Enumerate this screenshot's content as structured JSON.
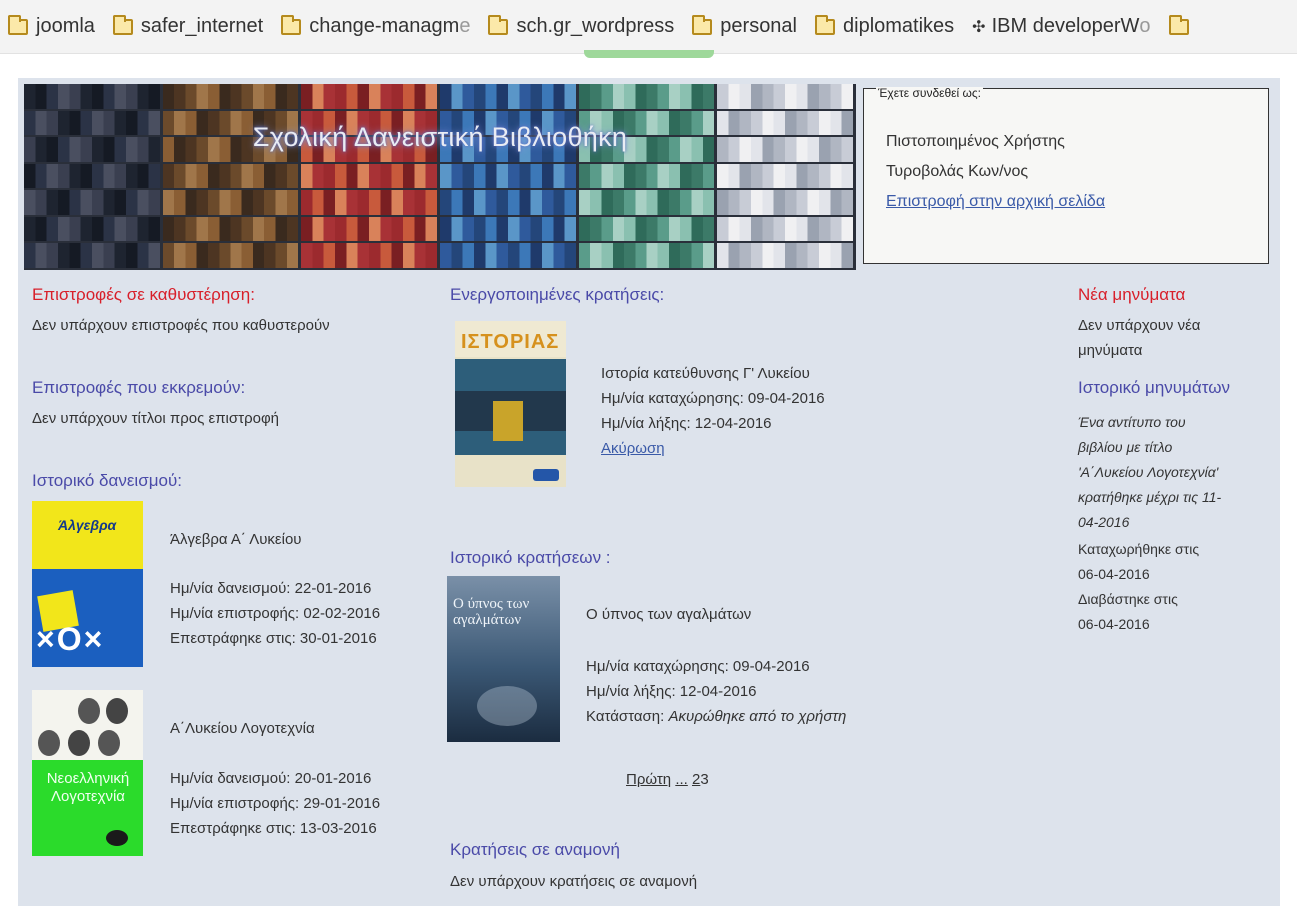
{
  "bookmarks": [
    {
      "label": "joomla",
      "icon": "folder-icon"
    },
    {
      "label": "safer_internet",
      "icon": "folder-icon"
    },
    {
      "label": "change-managm",
      "icon": "folder-icon",
      "faded_tail": "e"
    },
    {
      "label": "sch.gr_wordpress",
      "icon": "folder-icon"
    },
    {
      "label": "personal",
      "icon": "folder-icon"
    },
    {
      "label": "diplomatikes",
      "icon": "folder-icon"
    },
    {
      "label": "IBM developerW",
      "icon": "ibm-icon",
      "faded_tail": "o"
    }
  ],
  "banner": {
    "title": "Σχολική Δανειστική Βιβλιοθήκη"
  },
  "login": {
    "legend": "Έχετε συνδεθεί ως:",
    "role": "Πιστοποιημένος Χρήστης",
    "name": "Τυροβολάς  Κων/νος",
    "home_link": "Επιστροφή στην αρχική σελίδα"
  },
  "left": {
    "overdue_heading": "Επιστροφές σε καθυστέρηση:",
    "overdue_text": "Δεν υπάρχουν επιστροφές που καθυστερούν",
    "pending_heading": "Επιστροφές που εκκρεμούν:",
    "pending_text": "Δεν υπάρχουν τίτλοι προς επιστροφή",
    "history_heading": "Ιστορικό δανεισμού:",
    "loans": [
      {
        "title": "Άλγεβρα Α΄ Λυκείου",
        "loan_date": "Ημ/νία δανεισμού: 22-01-2016",
        "due_date": "Ημ/νία επιστροφής: 02-02-2016",
        "returned": "Επεστράφηκε στις: 30-01-2016",
        "cover_text": "Άλγεβρα"
      },
      {
        "title": "Α΄Λυκείου Λογοτεχνία",
        "loan_date": "Ημ/νία δανεισμού: 20-01-2016",
        "due_date": "Ημ/νία επιστροφής: 29-01-2016",
        "returned": "Επεστράφηκε στις: 13-03-2016",
        "cover_text": "Νεοελληνική Λογοτεχνία"
      }
    ]
  },
  "middle": {
    "active_heading": "Ενεργοποιημένες κρατήσεις:",
    "active": {
      "title": "Ιστορία κατεύθυνσης Γ' Λυκείου",
      "reg_date": "Ημ/νία καταχώρησης: 09-04-2016",
      "exp_date": "Ημ/νία λήξης: 12-04-2016",
      "cancel": "Ακύρωση ",
      "cover_text": "ΙΣΤΟΡΙΑΣ"
    },
    "history_heading": "Ιστορικό κρατήσεων :",
    "history": {
      "title": "Ο ύπνος των αγαλμάτων",
      "reg_date": "Ημ/νία καταχώρησης: 09-04-2016",
      "exp_date": "Ημ/νία λήξης: 12-04-2016",
      "status_label": "Κατάσταση: ",
      "status_value": "Ακυρώθηκε από το χρήστη",
      "cover_text": "Ο ύπνος των αγαλμάτων"
    },
    "pager": {
      "first": "Πρώτη",
      "dots": "...",
      "p2": "2",
      "p3": "3"
    },
    "waiting_heading": "Κρατήσεις σε αναμονή",
    "waiting_text": "Δεν υπάρχουν κρατήσεις σε αναμονή"
  },
  "right": {
    "new_heading": "Νέα μηνύματα",
    "new_text_1": "Δεν υπάρχουν νέα",
    "new_text_2": "μηνύματα",
    "history_heading": "Ιστορικό μηνυμάτων",
    "msg_lines": [
      "Ένα αντίτυπο του",
      "βιβλίου με τίτλο",
      "'Α΄Λυκείου Λογοτεχνία'",
      "κρατήθηκε μέχρι τις 11-",
      "04-2016"
    ],
    "registered_label": "Καταχωρήθηκε στις",
    "registered_date": "06-04-2016",
    "read_label": "Διαβάστηκε στις",
    "read_date": "06-04-2016"
  }
}
